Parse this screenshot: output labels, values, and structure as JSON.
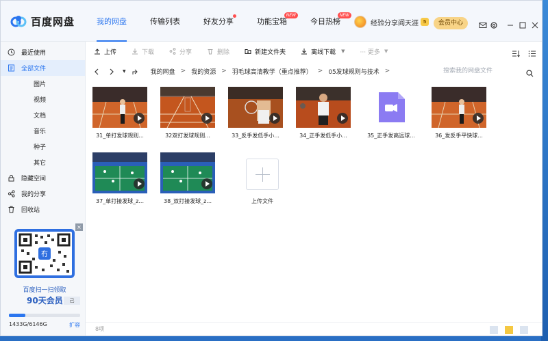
{
  "app": {
    "title": "百度网盘"
  },
  "nav": {
    "tabs": [
      {
        "label": "我的网盘",
        "active": true
      },
      {
        "label": "传输列表"
      },
      {
        "label": "好友分享",
        "dot": true
      },
      {
        "label": "功能宝箱",
        "badge": "NEW"
      },
      {
        "label": "今日热榜",
        "badge": "NEW"
      }
    ]
  },
  "user": {
    "name": "经验分享阎天涯",
    "level": "5",
    "vip_label": "会员中心"
  },
  "toolbar": {
    "upload": "上传",
    "download": "下载",
    "share": "分享",
    "delete": "删除",
    "new_folder": "新建文件夹",
    "offline": "离线下载",
    "more": "··· 更多"
  },
  "address": {
    "crumbs": [
      "我的网盘",
      "我的资源",
      "羽毛球高清教学（重点推荐）",
      "05发球规则与技术"
    ],
    "search_placeholder": "搜索我的网盘文件"
  },
  "sidebar": {
    "items": [
      {
        "label": "最近使用",
        "icon": "clock-icon"
      },
      {
        "label": "全部文件",
        "icon": "file-icon",
        "active": true
      },
      {
        "label": "图片",
        "sub": true
      },
      {
        "label": "视频",
        "sub": true
      },
      {
        "label": "文档",
        "sub": true
      },
      {
        "label": "音乐",
        "sub": true
      },
      {
        "label": "种子",
        "sub": true
      },
      {
        "label": "其它",
        "sub": true
      },
      {
        "label": "隐藏空间",
        "icon": "lock-icon"
      },
      {
        "label": "我的分享",
        "icon": "share-icon"
      },
      {
        "label": "回收站",
        "icon": "trash-icon"
      }
    ],
    "promo": {
      "line1": "百度扫一扫领取",
      "line2": "90天会员",
      "button": "己"
    },
    "storage": {
      "used": "1433G/6146G",
      "fraction": 0.233,
      "expand": "扩容"
    }
  },
  "files": [
    {
      "name": "31_单打发球规则...",
      "type": "video",
      "scene": "court-player"
    },
    {
      "name": "32双打发球规则...",
      "type": "video",
      "scene": "court-net"
    },
    {
      "name": "33_反手发低手小...",
      "type": "video",
      "scene": "close-up"
    },
    {
      "name": "34_正手发低手小...",
      "type": "video",
      "scene": "player-close"
    },
    {
      "name": "35_正手发高远球...",
      "type": "video-icon"
    },
    {
      "name": "36_发反手平快球...",
      "type": "video",
      "scene": "court-player"
    },
    {
      "name": "37_单打接发球_z...",
      "type": "video",
      "scene": "court-wide"
    },
    {
      "name": "38_双打接发球_z...",
      "type": "video",
      "scene": "court-wide"
    }
  ],
  "upload_tile": {
    "label": "上传文件"
  },
  "status": {
    "count": "8项"
  }
}
